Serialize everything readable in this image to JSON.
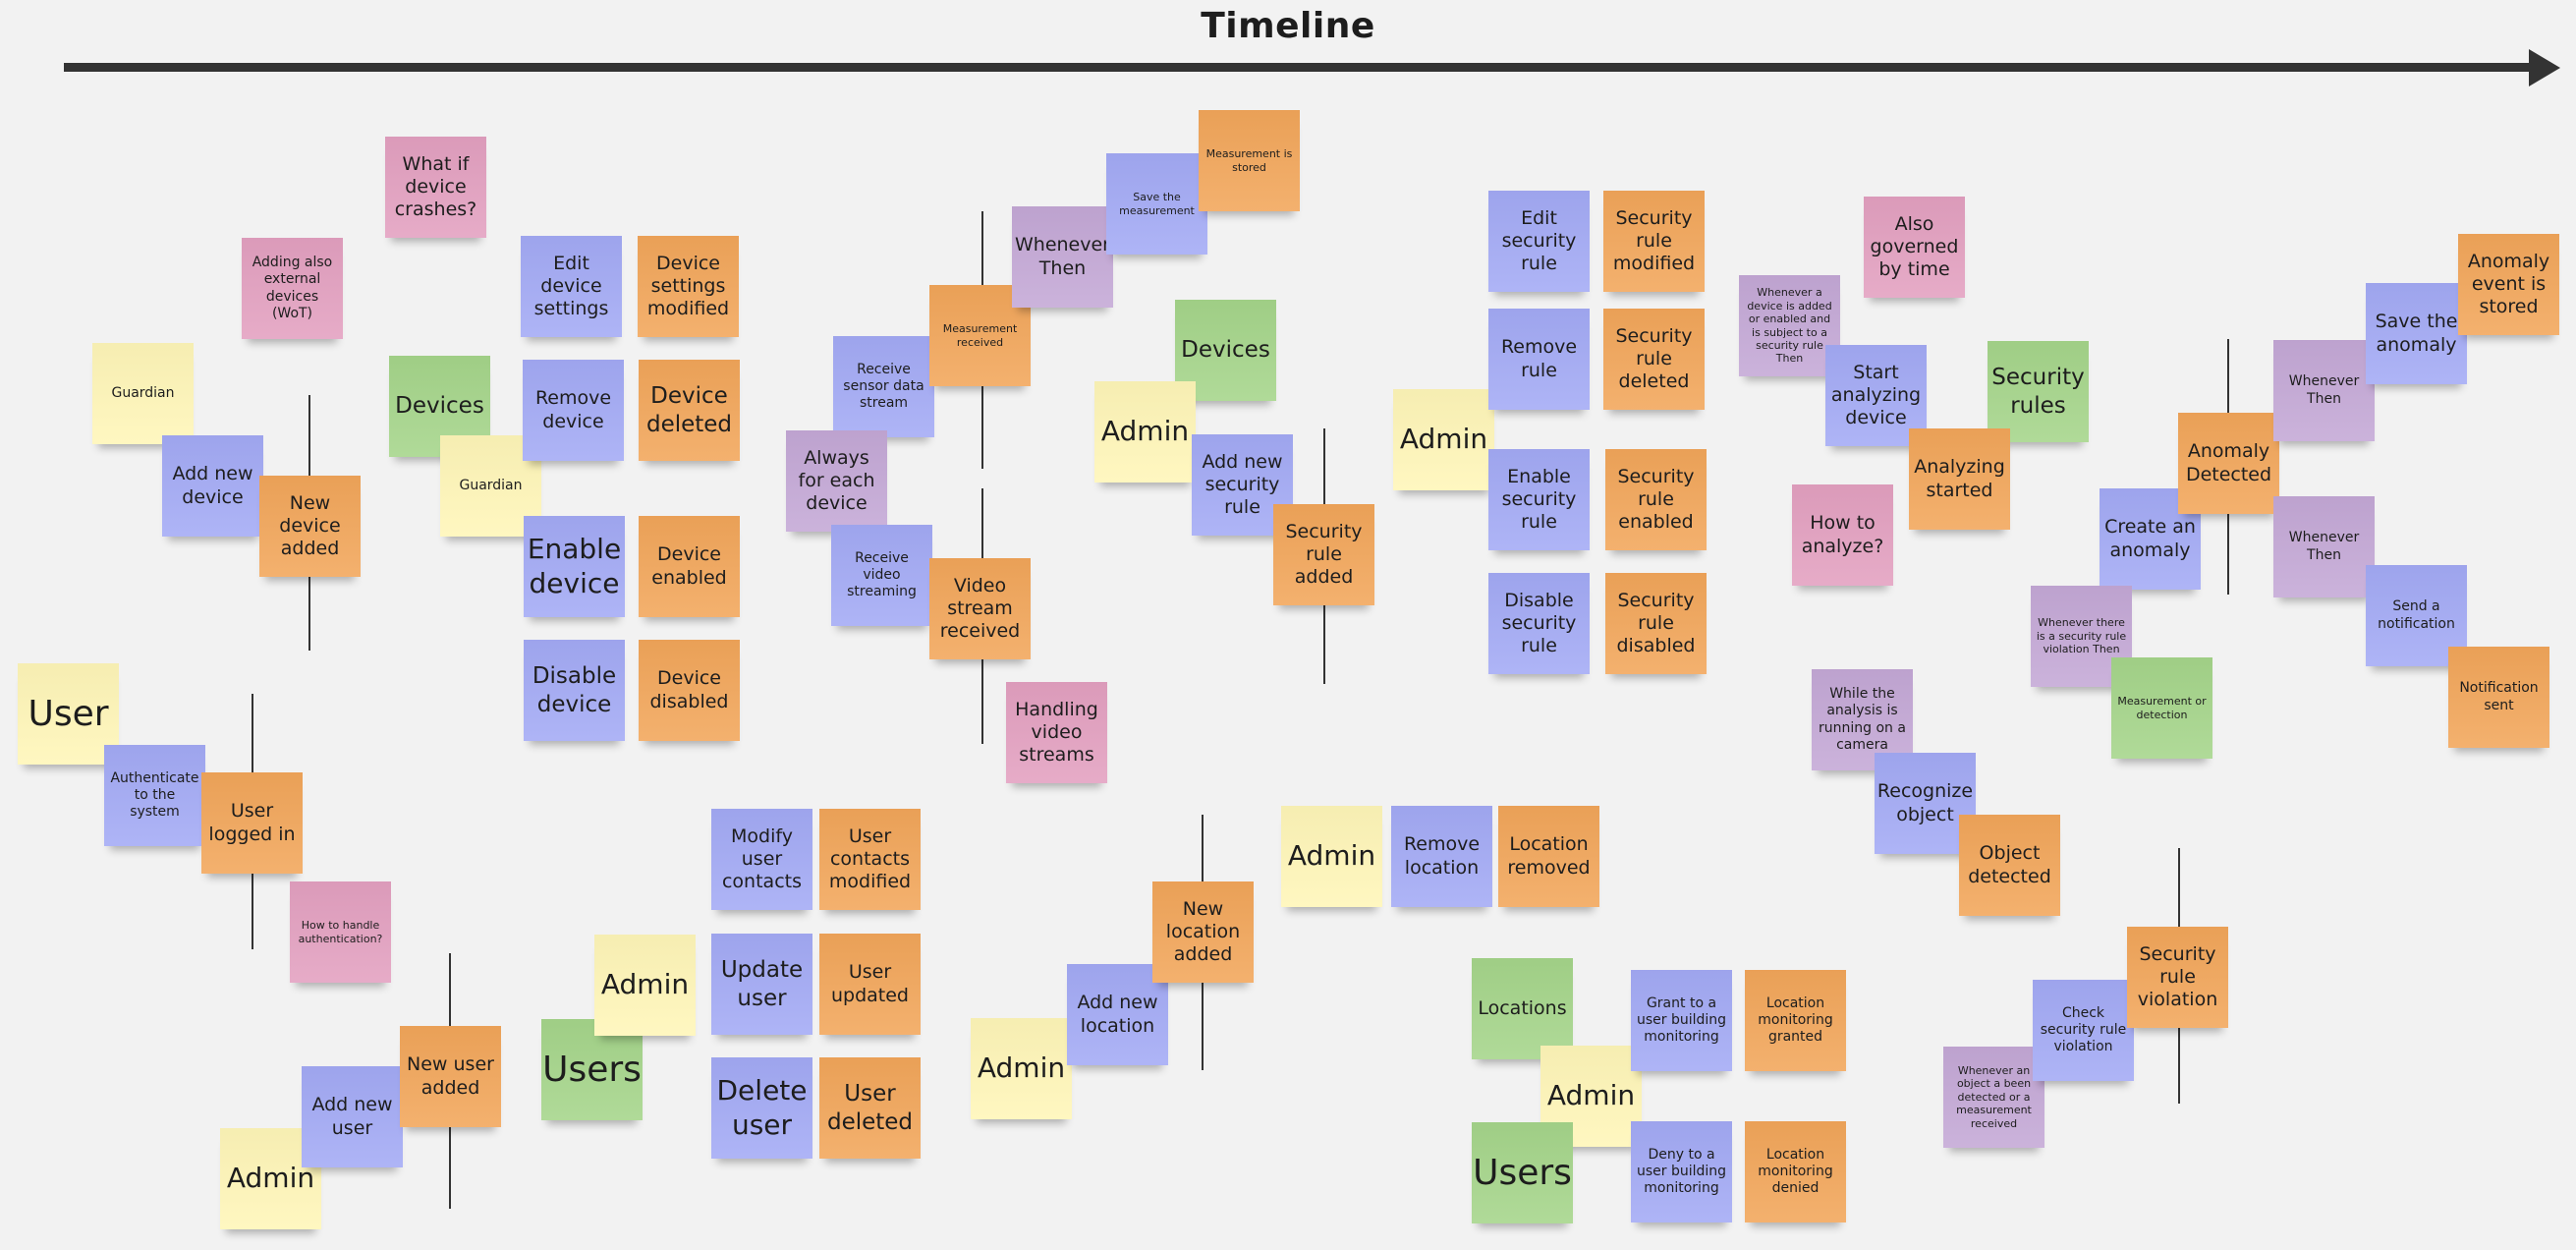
{
  "board": {
    "title": "Timeline",
    "legend_colors": {
      "command": "#a3aaf5",
      "event": "#f2a65a",
      "actor": "#fff6b8",
      "aggregate": "#a5d58a",
      "question": "#e3a0c0",
      "policy": "#c4a8d6"
    }
  },
  "notes": {
    "what_if_device_crashes": "What if device crashes?",
    "adding_external_devices": "Adding also external devices (WoT)",
    "guardian_1": "Guardian",
    "add_new_device": "Add new device",
    "new_device_added": "New device added",
    "devices_1": "Devices",
    "guardian_2": "Guardian",
    "edit_device_settings": "Edit device settings",
    "device_settings_modified": "Device settings modified",
    "remove_device": "Remove device",
    "device_deleted": "Device deleted",
    "enable_device": "Enable device",
    "device_enabled": "Device enabled",
    "disable_device": "Disable device",
    "device_disabled": "Device disabled",
    "user_actor": "User",
    "authenticate": "Authenticate to the system",
    "user_logged_in": "User logged in",
    "how_to_handle_auth": "How to handle authentication?",
    "admin_1": "Admin",
    "add_new_user": "Add new user",
    "new_user_added": "New user added",
    "users_1": "Users",
    "admin_2": "Admin",
    "modify_user_contacts": "Modify user contacts",
    "user_contacts_modified": "User contacts modified",
    "update_user": "Update user",
    "user_updated": "User updated",
    "delete_user": "Delete user",
    "user_deleted": "User deleted",
    "receive_sensor_data": "Receive sensor data stream",
    "measurement_received": "Measurement received",
    "whenever_then_1": "Whenever Then",
    "save_the_measurement": "Save the measurement",
    "measurement_is_stored": "Measurement is stored",
    "always_for_each_device": "Always for each device",
    "receive_video_streaming": "Receive video streaming",
    "video_stream_received": "Video stream received",
    "handling_video_streams": "Handling video streams",
    "devices_2": "Devices",
    "admin_3": "Admin",
    "add_new_security_rule": "Add new security rule",
    "security_rule_added": "Security rule added",
    "admin_4": "Admin",
    "edit_security_rule": "Edit security rule",
    "security_rule_modified": "Security rule modified",
    "remove_rule": "Remove rule",
    "security_rule_deleted": "Security rule deleted",
    "enable_security_rule": "Enable security rule",
    "security_rule_enabled": "Security rule enabled",
    "disable_security_rule": "Disable security rule",
    "security_rule_disabled": "Security rule disabled",
    "admin_5": "Admin",
    "add_new_location": "Add new location",
    "new_location_added": "New location added",
    "admin_6": "Admin",
    "remove_location": "Remove location",
    "location_removed": "Location removed",
    "locations": "Locations",
    "admin_7": "Admin",
    "users_2": "Users",
    "grant_monitoring": "Grant to a user building monitoring",
    "location_monitoring_granted": "Location monitoring granted",
    "deny_monitoring": "Deny to a user building monitoring",
    "location_monitoring_denied": "Location monitoring denied",
    "policy_device_added": "Whenever a device is added or enabled and is subject to a security rule Then",
    "also_governed_by_time": "Also governed by time",
    "start_analyzing_device": "Start analyzing device",
    "security_rules": "Security rules",
    "analyzing_started": "Analyzing started",
    "how_to_analyze": "How to analyze?",
    "while_analysis_camera": "While the analysis is running on a camera",
    "recognize_object": "Recognize object",
    "object_detected": "Object detected",
    "policy_object_detected": "Whenever an object a been detected or a measurement received",
    "check_security_rule_violation": "Check security rule violation",
    "security_rule_violation": "Security rule violation",
    "create_an_anomaly": "Create an anomaly",
    "anomaly_detected": "Anomaly Detected",
    "whenever_then_2": "Whenever Then",
    "save_the_anomaly": "Save the anomaly",
    "anomaly_event_stored": "Anomaly event is stored",
    "whenever_then_3": "Whenever Then",
    "send_a_notification": "Send a notification",
    "notification_sent": "Notification sent",
    "policy_security_violation": "Whenever there is a security rule violation Then",
    "measurement_or_detection": "Measurement or detection"
  }
}
